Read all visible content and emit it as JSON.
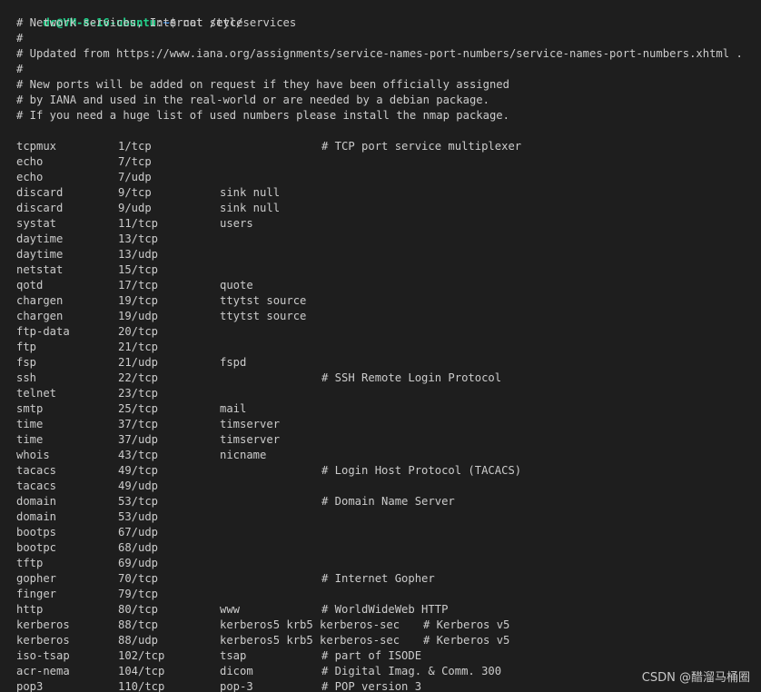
{
  "prompt": {
    "user_host": "dc@VM-8-16-ubuntu",
    "colon": ":",
    "cwd": "~",
    "dollar": "$",
    "command": " cat /etc/services"
  },
  "header_comments": [
    "# Network services, Internet style",
    "#",
    "# Updated from https://www.iana.org/assignments/service-names-port-numbers/service-names-port-numbers.xhtml .",
    "#",
    "# New ports will be added on request if they have been officially assigned",
    "# by IANA and used in the real-world or are needed by a debian package.",
    "# If you need a huge list of used numbers please install the nmap package."
  ],
  "services": [
    {
      "name": "tcpmux",
      "port": "1/tcp",
      "aliases": "",
      "comment": "# TCP port service multiplexer"
    },
    {
      "name": "echo",
      "port": "7/tcp",
      "aliases": "",
      "comment": ""
    },
    {
      "name": "echo",
      "port": "7/udp",
      "aliases": "",
      "comment": ""
    },
    {
      "name": "discard",
      "port": "9/tcp",
      "aliases": "sink null",
      "comment": ""
    },
    {
      "name": "discard",
      "port": "9/udp",
      "aliases": "sink null",
      "comment": ""
    },
    {
      "name": "systat",
      "port": "11/tcp",
      "aliases": "users",
      "comment": ""
    },
    {
      "name": "daytime",
      "port": "13/tcp",
      "aliases": "",
      "comment": ""
    },
    {
      "name": "daytime",
      "port": "13/udp",
      "aliases": "",
      "comment": ""
    },
    {
      "name": "netstat",
      "port": "15/tcp",
      "aliases": "",
      "comment": ""
    },
    {
      "name": "qotd",
      "port": "17/tcp",
      "aliases": "quote",
      "comment": ""
    },
    {
      "name": "chargen",
      "port": "19/tcp",
      "aliases": "ttytst source",
      "comment": ""
    },
    {
      "name": "chargen",
      "port": "19/udp",
      "aliases": "ttytst source",
      "comment": ""
    },
    {
      "name": "ftp-data",
      "port": "20/tcp",
      "aliases": "",
      "comment": ""
    },
    {
      "name": "ftp",
      "port": "21/tcp",
      "aliases": "",
      "comment": ""
    },
    {
      "name": "fsp",
      "port": "21/udp",
      "aliases": "fspd",
      "comment": ""
    },
    {
      "name": "ssh",
      "port": "22/tcp",
      "aliases": "",
      "comment": "# SSH Remote Login Protocol"
    },
    {
      "name": "telnet",
      "port": "23/tcp",
      "aliases": "",
      "comment": ""
    },
    {
      "name": "smtp",
      "port": "25/tcp",
      "aliases": "mail",
      "comment": ""
    },
    {
      "name": "time",
      "port": "37/tcp",
      "aliases": "timserver",
      "comment": ""
    },
    {
      "name": "time",
      "port": "37/udp",
      "aliases": "timserver",
      "comment": ""
    },
    {
      "name": "whois",
      "port": "43/tcp",
      "aliases": "nicname",
      "comment": ""
    },
    {
      "name": "tacacs",
      "port": "49/tcp",
      "aliases": "",
      "comment": "# Login Host Protocol (TACACS)"
    },
    {
      "name": "tacacs",
      "port": "49/udp",
      "aliases": "",
      "comment": ""
    },
    {
      "name": "domain",
      "port": "53/tcp",
      "aliases": "",
      "comment": "# Domain Name Server"
    },
    {
      "name": "domain",
      "port": "53/udp",
      "aliases": "",
      "comment": ""
    },
    {
      "name": "bootps",
      "port": "67/udp",
      "aliases": "",
      "comment": ""
    },
    {
      "name": "bootpc",
      "port": "68/udp",
      "aliases": "",
      "comment": ""
    },
    {
      "name": "tftp",
      "port": "69/udp",
      "aliases": "",
      "comment": ""
    },
    {
      "name": "gopher",
      "port": "70/tcp",
      "aliases": "",
      "comment": "# Internet Gopher"
    },
    {
      "name": "finger",
      "port": "79/tcp",
      "aliases": "",
      "comment": ""
    },
    {
      "name": "http",
      "port": "80/tcp",
      "aliases": "www",
      "comment": "# WorldWideWeb HTTP"
    },
    {
      "name": "kerberos",
      "port": "88/tcp",
      "aliases": "kerberos5 krb5 kerberos-sec",
      "comment": "# Kerberos v5"
    },
    {
      "name": "kerberos",
      "port": "88/udp",
      "aliases": "kerberos5 krb5 kerberos-sec",
      "comment": "# Kerberos v5"
    },
    {
      "name": "iso-tsap",
      "port": "102/tcp",
      "aliases": "tsap",
      "comment": "# part of ISODE"
    },
    {
      "name": "acr-nema",
      "port": "104/tcp",
      "aliases": "dicom",
      "comment": "# Digital Imag. & Comm. 300"
    },
    {
      "name": "pop3",
      "port": "110/tcp",
      "aliases": "pop-3",
      "comment": "# POP version 3"
    }
  ],
  "watermark": "CSDN @醋溜马桶圈",
  "colors": {
    "background": "#1e1e1e",
    "foreground": "#cccccc",
    "user_host": "#23d18b",
    "cwd": "#3b8eea"
  }
}
